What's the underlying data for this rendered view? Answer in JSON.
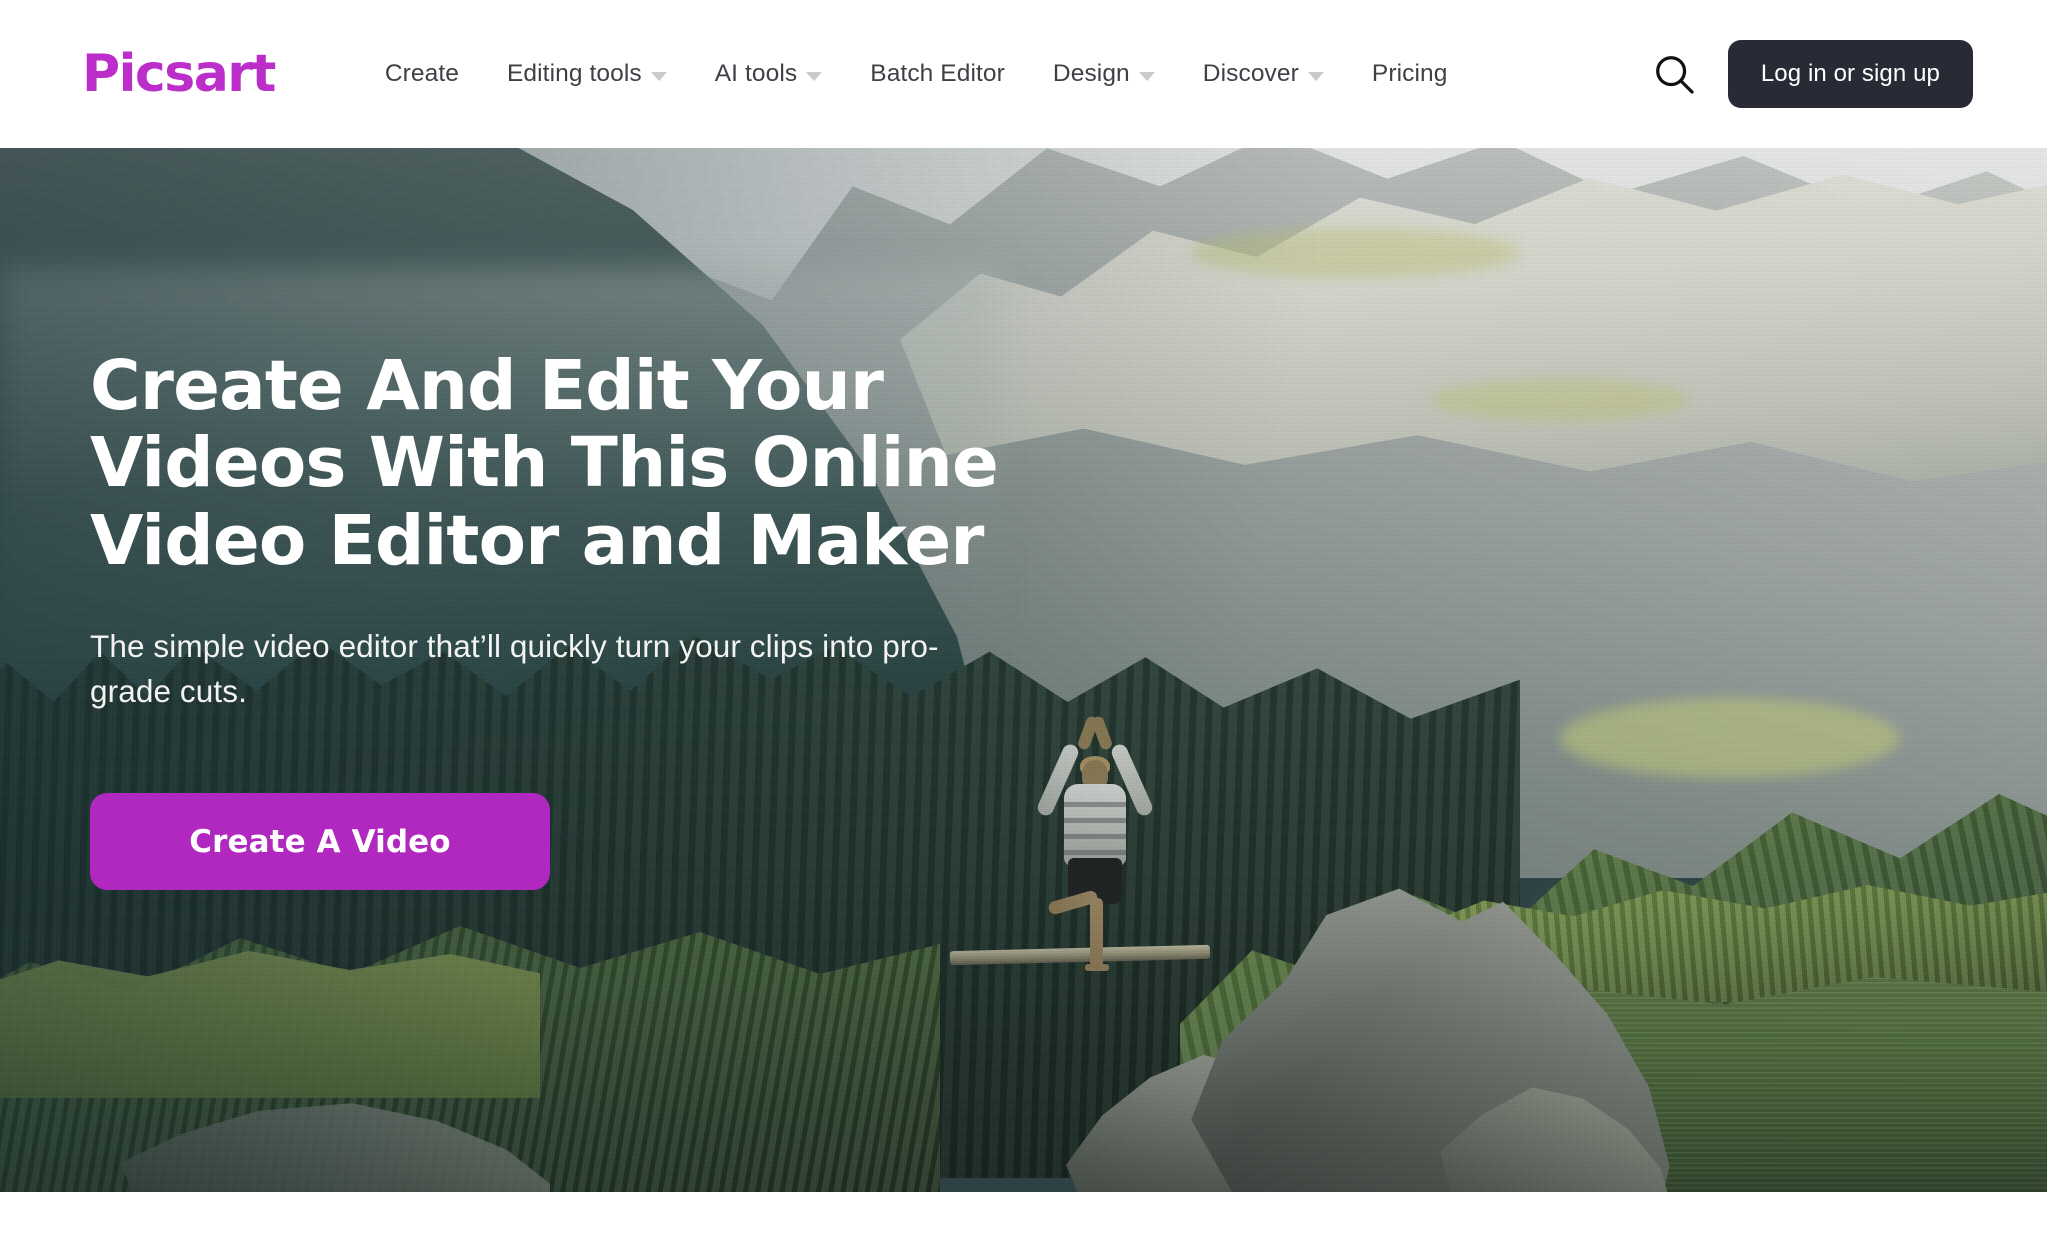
{
  "brand": {
    "name": "Picsart",
    "logo_color": "#bb2eca"
  },
  "header": {
    "nav_items": [
      {
        "label": "Create",
        "has_dropdown": false
      },
      {
        "label": "Editing tools",
        "has_dropdown": true
      },
      {
        "label": "AI tools",
        "has_dropdown": true
      },
      {
        "label": "Batch Editor",
        "has_dropdown": false
      },
      {
        "label": "Design",
        "has_dropdown": true
      },
      {
        "label": "Discover",
        "has_dropdown": true
      },
      {
        "label": "Pricing",
        "has_dropdown": false
      }
    ],
    "search_icon": "search-icon",
    "login_label": "Log in or sign up",
    "login_bg": "#282b36",
    "nav_text_color": "#3f3f46"
  },
  "hero": {
    "title": "Create And Edit Your Videos With This Online Video Editor and Maker",
    "title_lines": [
      "Create And Edit Your",
      "Videos With This Online",
      "Video Editor and Maker"
    ],
    "subtitle": "The simple video editor that’ll quickly turn your clips into pro-grade cuts.",
    "cta_label": "Create A Video",
    "cta_color": "#b028bf",
    "background_description": "Woman in tree-pose yoga stance on a wooden beam in front of alpine forest, limestone mountain massif and a lake"
  }
}
